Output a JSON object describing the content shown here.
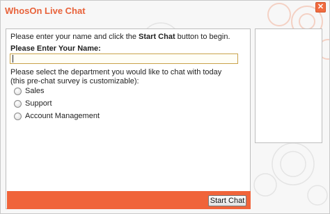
{
  "window": {
    "title": "WhosOn Live Chat",
    "close_glyph": "✕"
  },
  "form": {
    "intro_prefix": "Please enter your name and click the ",
    "intro_bold": "Start Chat",
    "intro_suffix": " button to begin.",
    "name_label": "Please Enter Your Name:",
    "name_value": "",
    "department_prompt": "Please select the department you would like to chat with today (this pre-chat survey is customizable):",
    "departments": [
      {
        "label": "Sales",
        "selected": false
      },
      {
        "label": "Support",
        "selected": false
      },
      {
        "label": "Account Management",
        "selected": false
      }
    ],
    "submit_label": "Start Chat"
  },
  "colors": {
    "accent": "#f0643a",
    "title": "#e8623a",
    "input_border": "#c9a24a"
  },
  "icons": {
    "close": "close-icon",
    "background": "gear-pattern-icon"
  }
}
